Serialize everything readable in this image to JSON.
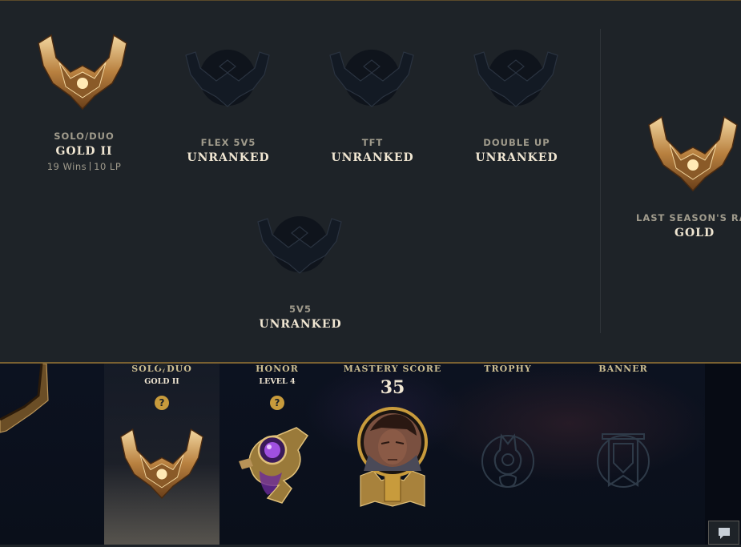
{
  "ranked": {
    "solo_duo": {
      "queue": "SOLO/DUO",
      "tier": "GOLD II",
      "wins": "19 Wins",
      "lp": "10 LP",
      "emblem": "gold-emblem"
    },
    "flex": {
      "queue": "FLEX 5V5",
      "tier": "UNRANKED",
      "emblem": "unranked-emblem"
    },
    "tft": {
      "queue": "TFT",
      "tier": "UNRANKED",
      "emblem": "unranked-emblem"
    },
    "double_up": {
      "queue": "DOUBLE UP",
      "tier": "UNRANKED",
      "emblem": "unranked-emblem"
    },
    "fivev5": {
      "queue": "5V5",
      "tier": "UNRANKED",
      "emblem": "unranked-emblem"
    },
    "last_season": {
      "queue": "LAST SEASON'S RANK",
      "tier": "GOLD",
      "emblem": "gold-emblem"
    }
  },
  "showcase": {
    "solo_duo": {
      "head": "SOLO/DUO",
      "sub": "GOLD II",
      "help": "?"
    },
    "honor": {
      "head": "HONOR",
      "sub": "LEVEL 4",
      "help": "?"
    },
    "mastery": {
      "head": "MASTERY SCORE",
      "score": "35"
    },
    "trophy": {
      "head": "TROPHY"
    },
    "banner": {
      "head": "BANNER"
    }
  },
  "colors": {
    "gold": "#c89b3c",
    "panel": "#1e2328",
    "text_light": "#f0e6d2",
    "text_muted": "#a09b8c"
  }
}
